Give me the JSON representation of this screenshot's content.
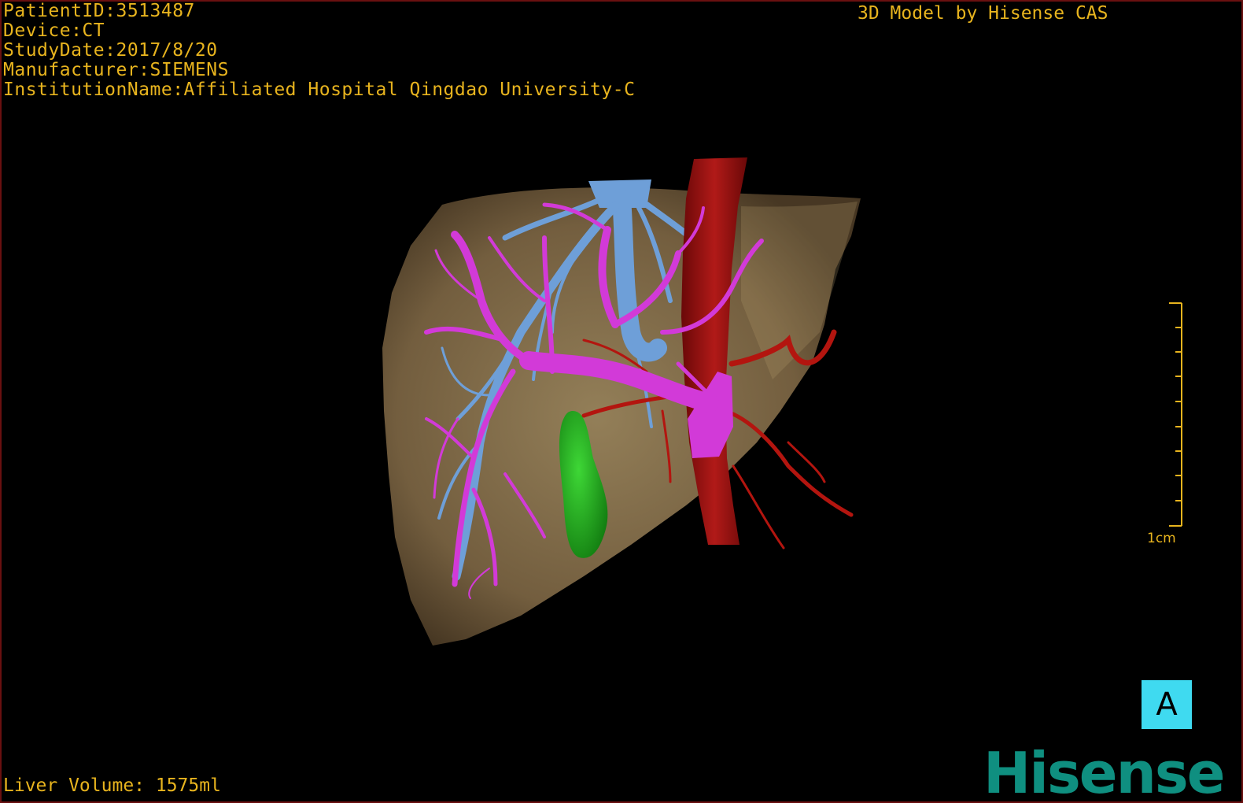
{
  "header": {
    "patient_id": "PatientID:3513487",
    "device": "Device:CT",
    "study_date": "StudyDate:2017/8/20",
    "manufacturer": "Manufacturer:SIEMENS",
    "institution": "InstitutionName:Affiliated Hospital Qingdao University-C"
  },
  "credit": "3D Model by Hisense CAS",
  "footer": {
    "liver_volume": "Liver Volume: 1575ml"
  },
  "scale_bar": {
    "label": "1cm"
  },
  "view_button": {
    "label": "A"
  },
  "brand": {
    "logo_text": "Hisense"
  },
  "colors": {
    "text": "#e8b41e",
    "liver": "#8a7250",
    "hepatic_vein": "#6e9fd8",
    "portal_vein": "#d23ad8",
    "artery": "#a10f10",
    "gallbladder": "#23a91c",
    "view_button": "#3fdaf0",
    "brand": "#0f8f80"
  }
}
